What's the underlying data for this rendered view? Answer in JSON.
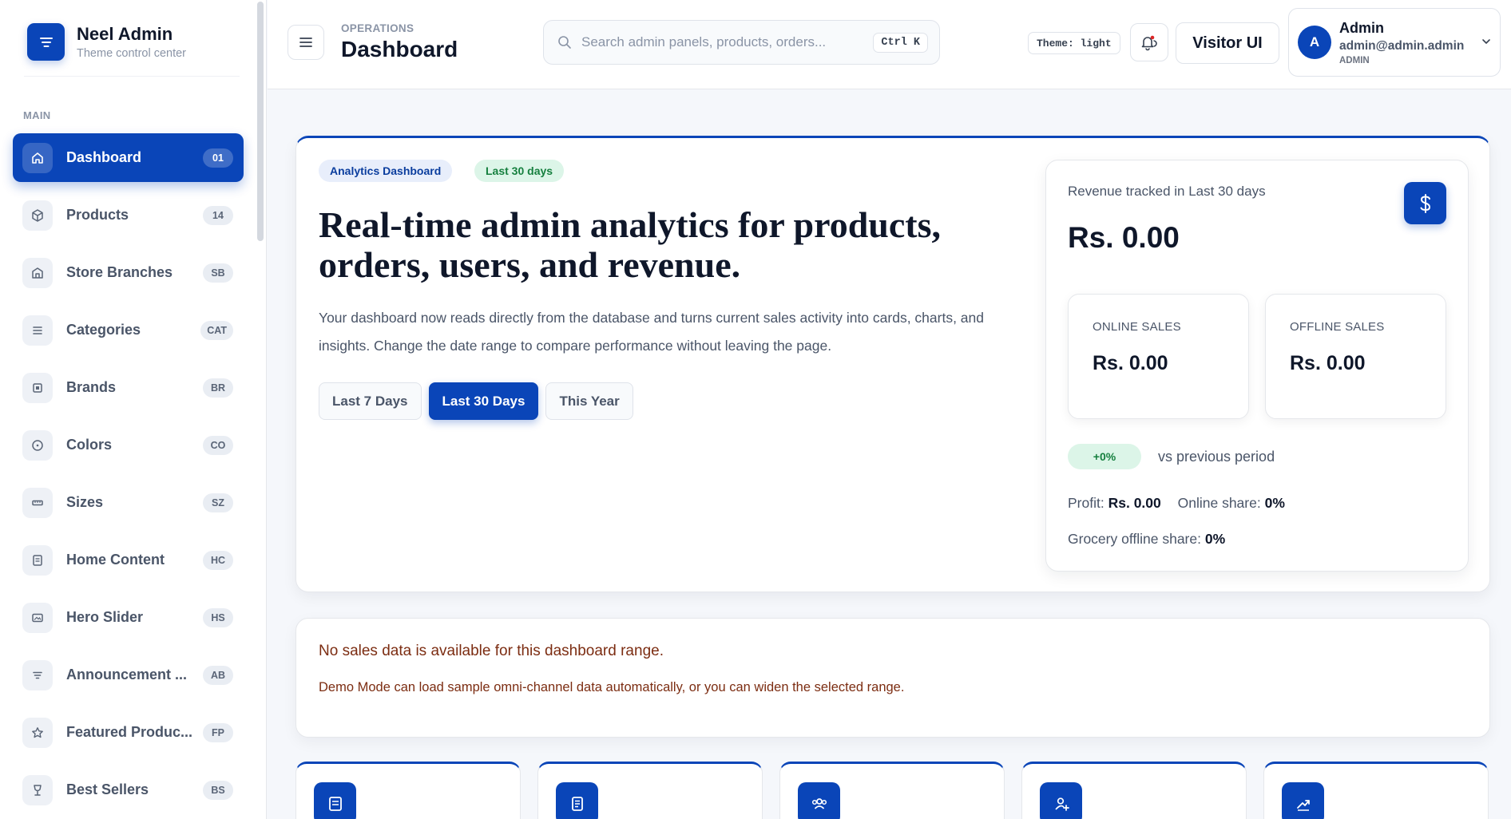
{
  "brand": {
    "name": "Neel Admin",
    "subtitle": "Theme control center"
  },
  "sidebar": {
    "section_label": "MAIN",
    "items": [
      {
        "label": "Dashboard",
        "badge": "01",
        "icon": "home-icon",
        "active": true
      },
      {
        "label": "Products",
        "badge": "14",
        "icon": "box-icon"
      },
      {
        "label": "Store Branches",
        "badge": "SB",
        "icon": "store-icon"
      },
      {
        "label": "Categories",
        "badge": "CAT",
        "icon": "list-icon"
      },
      {
        "label": "Brands",
        "badge": "BR",
        "icon": "brand-icon"
      },
      {
        "label": "Colors",
        "badge": "CO",
        "icon": "circle-icon"
      },
      {
        "label": "Sizes",
        "badge": "SZ",
        "icon": "ruler-icon"
      },
      {
        "label": "Home Content",
        "badge": "HC",
        "icon": "document-icon"
      },
      {
        "label": "Hero Slider",
        "badge": "HS",
        "icon": "image-icon"
      },
      {
        "label": "Announcement ...",
        "badge": "AB",
        "icon": "filter-icon"
      },
      {
        "label": "Featured Produc...",
        "badge": "FP",
        "icon": "star-icon"
      },
      {
        "label": "Best Sellers",
        "badge": "BS",
        "icon": "trophy-icon"
      }
    ]
  },
  "header": {
    "crumb": "OPERATIONS",
    "title": "Dashboard",
    "search_placeholder": "Search admin panels, products, orders...",
    "shortcut": "Ctrl K",
    "theme_chip": "Theme: light",
    "visitor_button": "Visitor UI",
    "user": {
      "initial": "A",
      "name": "Admin",
      "email": "admin@admin.admin",
      "role": "ADMIN"
    }
  },
  "hero": {
    "tag_primary": "Analytics Dashboard",
    "tag_range": "Last 30 days",
    "title": "Real-time admin analytics for products, orders, users, and revenue.",
    "description": "Your dashboard now reads directly from the database and turns current sales activity into cards, charts, and insights. Change the date range to compare performance without leaving the page.",
    "ranges": [
      {
        "label": "Last 7 Days",
        "active": false
      },
      {
        "label": "Last 30 Days",
        "active": true
      },
      {
        "label": "This Year",
        "active": false
      }
    ]
  },
  "revenue": {
    "label": "Revenue tracked in Last 30 days",
    "value": "Rs. 0.00",
    "online_label": "ONLINE SALES",
    "online_value": "Rs. 0.00",
    "offline_label": "OFFLINE SALES",
    "offline_value": "Rs. 0.00",
    "delta": "+0%",
    "delta_text": "vs previous period",
    "profit_label": "Profit:",
    "profit_value": "Rs. 0.00",
    "online_share_label": "Online share:",
    "online_share_value": "0%",
    "grocery_label": "Grocery offline share:",
    "grocery_value": "0%"
  },
  "notice": {
    "title": "No sales data is available for this dashboard range.",
    "body": "Demo Mode can load sample omni-channel data automatically, or you can widen the selected range."
  },
  "stat_cards": [
    {
      "icon": "document-icon"
    },
    {
      "icon": "receipt-icon"
    },
    {
      "icon": "users-icon"
    },
    {
      "icon": "user-add-icon"
    },
    {
      "icon": "trend-icon"
    }
  ],
  "colors": {
    "primary": "#0a45b8",
    "success_bg": "#dcf5e8",
    "success_text": "#16803f",
    "warning_text": "#7c2d12"
  }
}
